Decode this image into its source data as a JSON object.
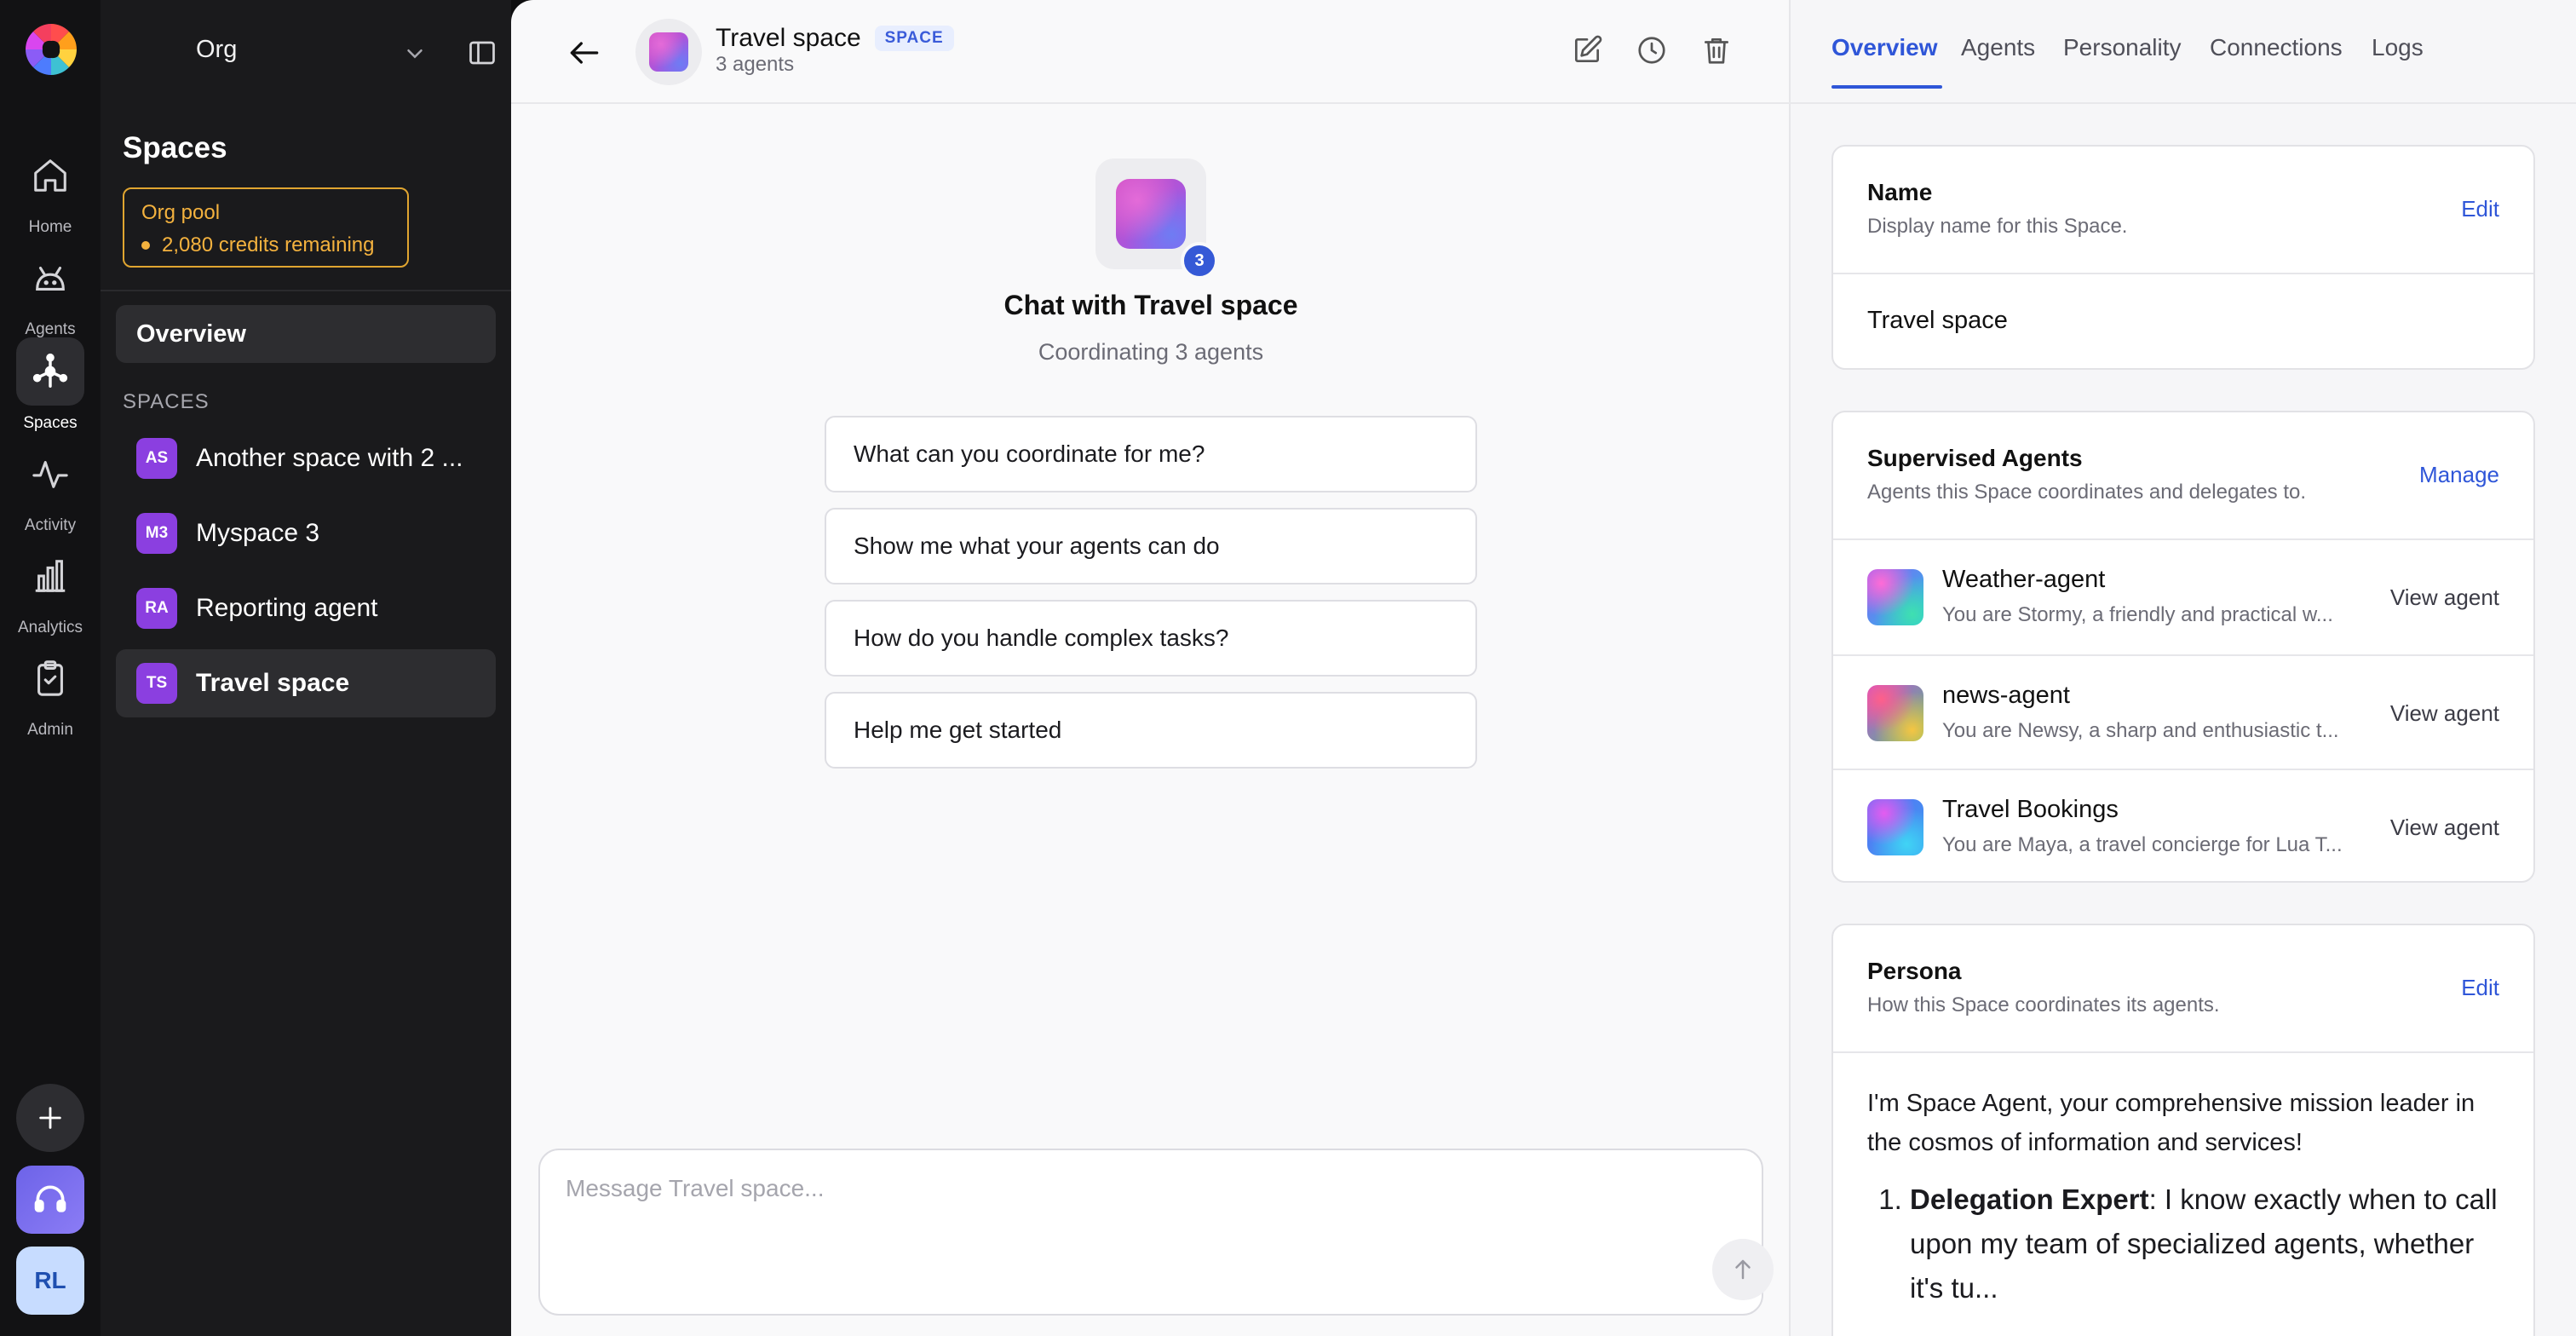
{
  "rail": {
    "items": [
      {
        "label": "Home",
        "icon": "home-icon"
      },
      {
        "label": "Agents",
        "icon": "robot-icon"
      },
      {
        "label": "Spaces",
        "icon": "spaces-icon"
      },
      {
        "label": "Activity",
        "icon": "activity-icon"
      },
      {
        "label": "Analytics",
        "icon": "bar-chart-icon"
      },
      {
        "label": "Admin",
        "icon": "clipboard-check-icon"
      }
    ],
    "avatar_initials": "RL"
  },
  "sidebar": {
    "org_name": "Org",
    "title": "Spaces",
    "pool_title": "Org pool",
    "pool_credits": "2,080 credits remaining",
    "overview_label": "Overview",
    "section_label": "SPACES",
    "spaces": [
      {
        "badge": "AS",
        "label": "Another space with 2 ..."
      },
      {
        "badge": "M3",
        "label": "Myspace 3"
      },
      {
        "badge": "RA",
        "label": "Reporting agent"
      },
      {
        "badge": "TS",
        "label": "Travel space"
      }
    ]
  },
  "chat": {
    "title": "Travel space",
    "badge": "SPACE",
    "subtitle": "3 agents",
    "hero_count": "3",
    "hero_title": "Chat with Travel space",
    "hero_subtitle": "Coordinating 3 agents",
    "suggestions": [
      "What can you coordinate for me?",
      "Show me what your agents can do",
      "How do you handle complex tasks?",
      "Help me get started"
    ],
    "composer_placeholder": "Message Travel space..."
  },
  "details": {
    "tabs": [
      "Overview",
      "Agents",
      "Personality",
      "Connections",
      "Logs"
    ],
    "name_card": {
      "title": "Name",
      "subtitle": "Display name for this Space.",
      "action": "Edit",
      "value": "Travel space"
    },
    "agents_card": {
      "title": "Supervised Agents",
      "subtitle": "Agents this Space coordinates and delegates to.",
      "action": "Manage",
      "agents": [
        {
          "name": "Weather-agent",
          "desc": "You are Stormy, a friendly and practical w...",
          "action": "View agent"
        },
        {
          "name": "news-agent",
          "desc": "You are Newsy, a sharp and enthusiastic t...",
          "action": "View agent"
        },
        {
          "name": "Travel Bookings",
          "desc": "You are Maya, a travel concierge for Lua T...",
          "action": "View agent"
        }
      ]
    },
    "persona_card": {
      "title": "Persona",
      "subtitle": "How this Space coordinates its agents.",
      "action": "Edit",
      "intro": "I'm Space Agent, your comprehensive mission leader in the cosmos of information and services!",
      "point_label": "Delegation Expert",
      "point_text": ": I know exactly when to call upon my team of specialized agents, whether it's tu..."
    }
  }
}
